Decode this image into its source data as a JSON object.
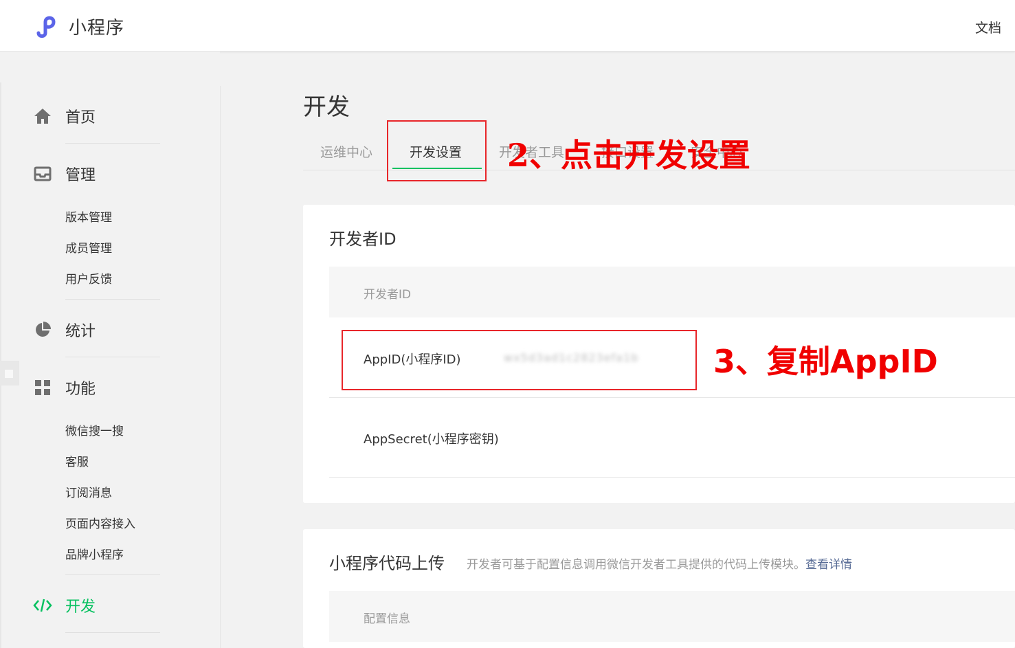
{
  "header": {
    "app_title": "小程序",
    "doc_link": "文档"
  },
  "sidebar": {
    "home": "首页",
    "manage": {
      "label": "管理",
      "items": [
        "版本管理",
        "成员管理",
        "用户反馈"
      ]
    },
    "stats": "统计",
    "features": {
      "label": "功能",
      "items": [
        "微信搜一搜",
        "客服",
        "订阅消息",
        "页面内容接入",
        "品牌小程序"
      ]
    },
    "dev": "开发"
  },
  "main": {
    "title": "开发",
    "tabs": [
      {
        "label": "运维中心",
        "active": false
      },
      {
        "label": "开发设置",
        "active": true
      },
      {
        "label": "开发者工具",
        "active": false
      },
      {
        "label": "接口设置",
        "active": false
      },
      {
        "label": "安全中心",
        "active": false
      }
    ],
    "dev_id_card": {
      "title": "开发者ID",
      "table_header": "开发者ID",
      "rows": [
        {
          "label": "AppID(小程序ID)",
          "value": "wx5d3ad1c2823efa1b"
        },
        {
          "label": "AppSecret(小程序密钥)",
          "value": ""
        }
      ]
    },
    "upload_card": {
      "title": "小程序代码上传",
      "description": "开发者可基于配置信息调用微信开发者工具提供的代码上传模块。",
      "link": "查看详情",
      "table_header": "配置信息"
    }
  },
  "annotations": {
    "step2": "2、点击开发设置",
    "step3": "3、复制AppID"
  },
  "colors": {
    "accent": "#07c160",
    "annotation": "#f00000",
    "link": "#576b95",
    "logo": "#5b64e8"
  }
}
